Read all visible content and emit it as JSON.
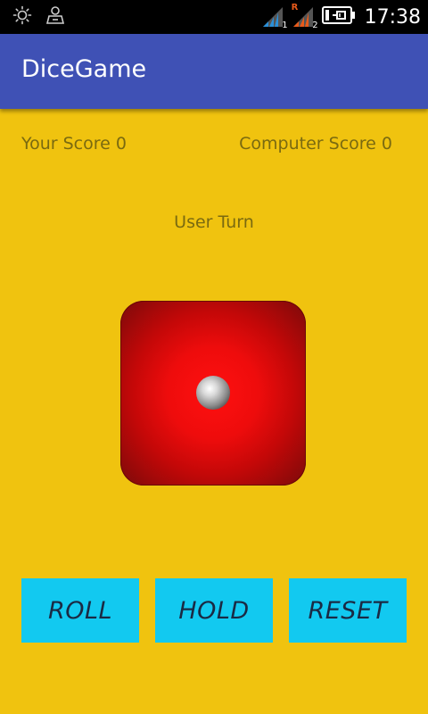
{
  "status_bar": {
    "time": "17:38",
    "sim1_label": "1",
    "sim2_label": "2",
    "roaming_label": "R"
  },
  "app_bar": {
    "title": "DiceGame"
  },
  "scores": {
    "user": "Your Score 0",
    "computer": "Computer Score 0"
  },
  "turn": {
    "label": "User Turn"
  },
  "die": {
    "value": 1
  },
  "buttons": {
    "roll": "ROLL",
    "hold": "HOLD",
    "reset": "RESET"
  },
  "colors": {
    "background": "#F0C30F",
    "app_bar": "#3F51B5",
    "button": "#12C9F0",
    "die": "#E80C0C"
  }
}
